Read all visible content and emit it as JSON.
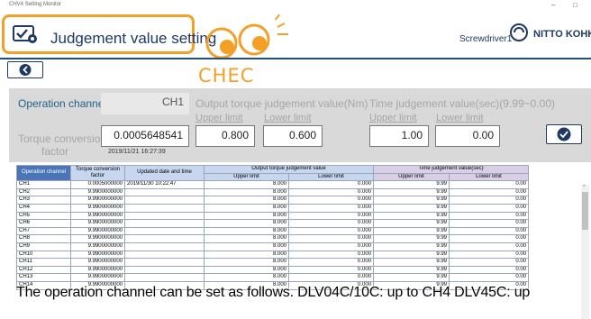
{
  "window": {
    "app_title": "CHV4 Setting Monitor",
    "minimize": "–",
    "maximize": "□"
  },
  "header": {
    "title": "Judgement value setting",
    "screwdriver": "Screwdriver1",
    "logo_text": "NITTO KOHKI",
    "icon": "check-gear-icon"
  },
  "watermark": {
    "chec": "CHEC"
  },
  "form": {
    "operation_channel_label": "Operation channel",
    "operation_channel_value": "CH1",
    "torque_conversion_label_1": "Torque conversion",
    "torque_conversion_label_2": "factor",
    "torque_conversion_value": "0.0005648541",
    "timestamp": "2019/11/21 16:27:39",
    "output_torque_label": "Output torque judgement value(Nm)",
    "torque_upper_label": "Upper limit",
    "torque_lower_label": "Lower limit",
    "torque_upper_value": "0.800",
    "torque_lower_value": "0.600",
    "time_label": "Time judgement value(sec)(9.99~0.00)",
    "time_upper_label": "Upper limit",
    "time_lower_label": "Lower limit",
    "time_upper_value": "1.00",
    "time_lower_value": "0.00"
  },
  "table": {
    "headers": {
      "operation_channel": "Operation channel",
      "torque_conversion": "Torque conversion factor",
      "updated": "Updated date and time",
      "output_torque": "Output torque judgement value",
      "time_judgement": "Time judgement value(sec)",
      "upper": "Upper limit",
      "lower": "Lower limit"
    },
    "rows": [
      [
        "CH1",
        "0.0005000000",
        "2019/11/30 10:22:47",
        "8.000",
        "0.000",
        "9.99",
        "0.00"
      ],
      [
        "CH2",
        "9.9900000000",
        "",
        "8.000",
        "0.000",
        "9.99",
        "0.00"
      ],
      [
        "CH3",
        "9.9900000000",
        "",
        "8.000",
        "0.000",
        "9.99",
        "0.00"
      ],
      [
        "CH4",
        "9.9900000000",
        "",
        "8.000",
        "0.000",
        "9.99",
        "0.00"
      ],
      [
        "CH5",
        "9.9900000000",
        "",
        "8.000",
        "0.000",
        "9.99",
        "0.00"
      ],
      [
        "CH6",
        "9.9900000000",
        "",
        "8.000",
        "0.000",
        "9.99",
        "0.00"
      ],
      [
        "CH7",
        "9.9900000000",
        "",
        "8.000",
        "0.000",
        "9.99",
        "0.00"
      ],
      [
        "CH8",
        "9.9900000000",
        "",
        "8.000",
        "0.000",
        "9.99",
        "0.00"
      ],
      [
        "CH9",
        "9.9900000000",
        "",
        "8.000",
        "0.000",
        "9.99",
        "0.00"
      ],
      [
        "CH10",
        "9.9900000000",
        "",
        "8.000",
        "0.000",
        "9.99",
        "0.00"
      ],
      [
        "CH11",
        "9.9900000000",
        "",
        "8.000",
        "0.000",
        "9.99",
        "0.00"
      ],
      [
        "CH12",
        "9.9900000000",
        "",
        "8.000",
        "0.000",
        "9.99",
        "0.00"
      ],
      [
        "CH13",
        "9.9900000000",
        "",
        "8.000",
        "0.000",
        "9.99",
        "0.00"
      ],
      [
        "CH14",
        "9.9900000000",
        "",
        "8.000",
        "0.000",
        "9.99",
        "0.00"
      ]
    ]
  },
  "caption": "The operation channel can be set as follows. DLV04C/10C: up to CH4 DLV45C: up",
  "colors": {
    "accent_orange": "#f2a028",
    "navy": "#1f3864",
    "header_blue": "#4a76b8"
  }
}
